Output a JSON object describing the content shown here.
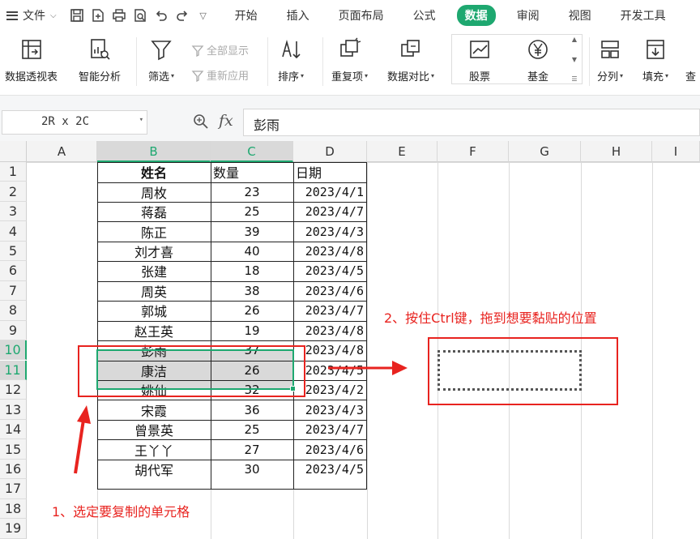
{
  "menu": {
    "file_label": "文件",
    "tabs": [
      {
        "label": "开始",
        "active": false
      },
      {
        "label": "插入",
        "active": false
      },
      {
        "label": "页面布局",
        "active": false
      },
      {
        "label": "公式",
        "active": false
      },
      {
        "label": "数据",
        "active": true
      },
      {
        "label": "审阅",
        "active": false
      },
      {
        "label": "视图",
        "active": false
      },
      {
        "label": "开发工具",
        "active": false
      }
    ]
  },
  "ribbon": {
    "pivot_table": "数据透视表",
    "smart_analysis": "智能分析",
    "filter": "筛选",
    "show_all": "全部显示",
    "reapply": "重新应用",
    "sort": "排序",
    "duplicates": "重复项",
    "compare": "数据对比",
    "stock": "股票",
    "fund": "基金",
    "split": "分列",
    "fill": "填充",
    "lookup": "查"
  },
  "formula_bar": {
    "name_box": "2R x 2C",
    "fx": "fx",
    "content": "彭雨"
  },
  "columns": [
    "A",
    "B",
    "C",
    "D",
    "E",
    "F",
    "G",
    "H",
    "I"
  ],
  "rows": [
    "1",
    "2",
    "3",
    "4",
    "5",
    "6",
    "7",
    "8",
    "9",
    "10",
    "11",
    "12",
    "13",
    "14",
    "15",
    "16",
    "17",
    "18",
    "19"
  ],
  "table": {
    "headers": {
      "name": "姓名",
      "qty": "数量",
      "date": "日期"
    },
    "records": [
      {
        "name": "周枚",
        "qty": "23",
        "date": "2023/4/1"
      },
      {
        "name": "蒋磊",
        "qty": "25",
        "date": "2023/4/7"
      },
      {
        "name": "陈正",
        "qty": "39",
        "date": "2023/4/3"
      },
      {
        "name": "刘才喜",
        "qty": "40",
        "date": "2023/4/8"
      },
      {
        "name": "张建",
        "qty": "18",
        "date": "2023/4/5"
      },
      {
        "name": "周英",
        "qty": "38",
        "date": "2023/4/6"
      },
      {
        "name": "郭城",
        "qty": "26",
        "date": "2023/4/7"
      },
      {
        "name": "赵王英",
        "qty": "19",
        "date": "2023/4/8"
      },
      {
        "name": "彭雨",
        "qty": "37",
        "date": "2023/4/8"
      },
      {
        "name": "康洁",
        "qty": "26",
        "date": "2023/4/5"
      },
      {
        "name": "姚仙",
        "qty": "32",
        "date": "2023/4/2"
      },
      {
        "name": "宋霞",
        "qty": "36",
        "date": "2023/4/3"
      },
      {
        "name": "曾景英",
        "qty": "25",
        "date": "2023/4/7"
      },
      {
        "name": "王丫丫",
        "qty": "27",
        "date": "2023/4/6"
      },
      {
        "name": "胡代军",
        "qty": "30",
        "date": "2023/4/5"
      }
    ]
  },
  "annotations": {
    "step1": "1、选定要复制的单元格",
    "step2": "2、按住Ctrl键，拖到想要黏贴的位置"
  },
  "colors": {
    "accent": "#1ea870",
    "annotation": "#e8231f"
  }
}
